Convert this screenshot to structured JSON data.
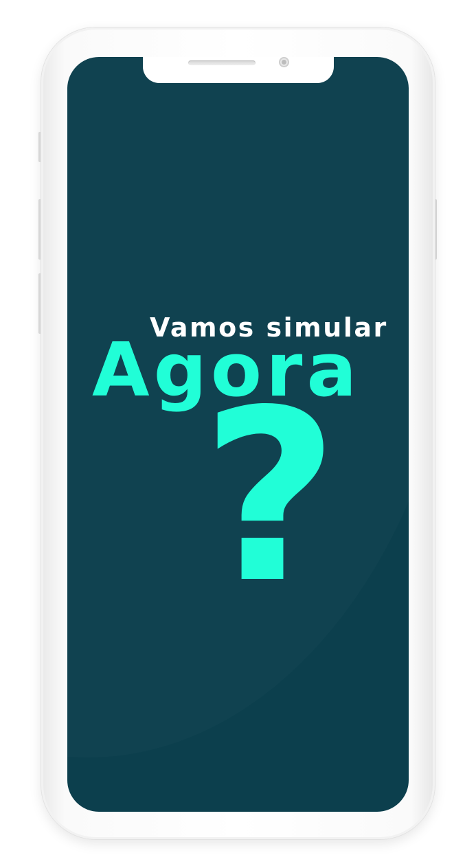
{
  "screen": {
    "subtitle": "Vamos simular",
    "headline": "Agora",
    "question_mark": "?"
  },
  "colors": {
    "screen_background": "#0c3f4d",
    "accent": "#21fed7",
    "subtitle_text": "#ffffff"
  }
}
